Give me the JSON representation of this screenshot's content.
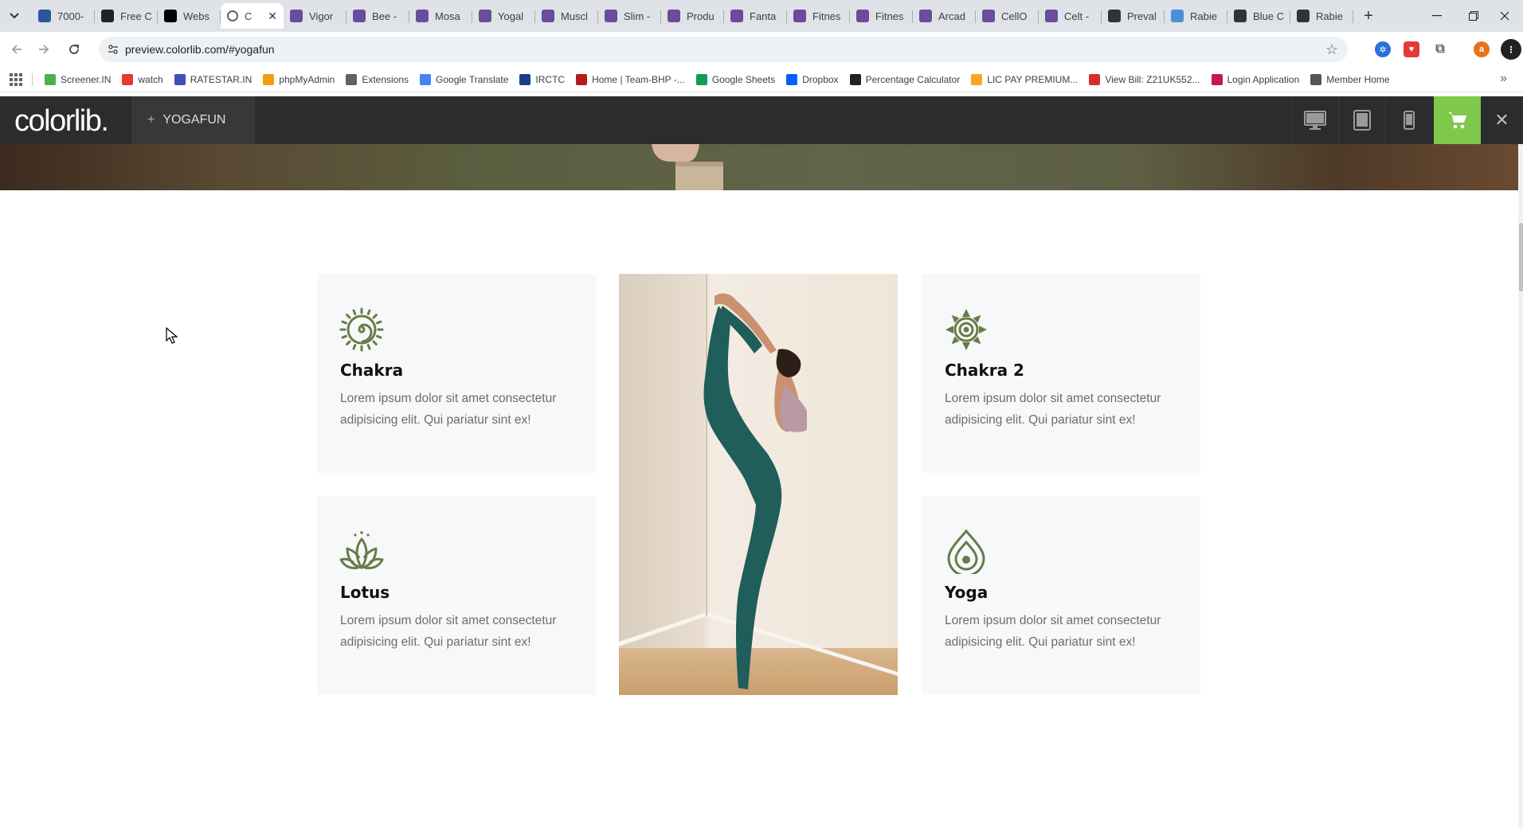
{
  "browser": {
    "tabs": [
      {
        "title": "7000-",
        "favicon": "word-icon",
        "color": "#2b579a"
      },
      {
        "title": "Free C",
        "favicon": "framer-icon",
        "color": "#222222"
      },
      {
        "title": "Webs",
        "favicon": "wix-icon",
        "color": "#000000"
      },
      {
        "title": "C",
        "favicon": "globe-icon",
        "color": "#5f6368",
        "active": true
      },
      {
        "title": "Vigor",
        "favicon": "colorlib-icon",
        "color": "#6b4c9a"
      },
      {
        "title": "Bee -",
        "favicon": "colorlib-icon",
        "color": "#6b4c9a"
      },
      {
        "title": "Mosa",
        "favicon": "colorlib-icon",
        "color": "#6b4c9a"
      },
      {
        "title": "Yogal",
        "favicon": "colorlib-icon",
        "color": "#6b4c9a"
      },
      {
        "title": "Muscl",
        "favicon": "colorlib-icon",
        "color": "#6b4c9a"
      },
      {
        "title": "Slim -",
        "favicon": "colorlib-icon",
        "color": "#6b4c9a"
      },
      {
        "title": "Produ",
        "favicon": "colorlib-icon",
        "color": "#6b4c9a"
      },
      {
        "title": "Fanta",
        "favicon": "colorlib-icon",
        "color": "#6b4c9a"
      },
      {
        "title": "Fitnes",
        "favicon": "colorlib-icon",
        "color": "#6b4c9a"
      },
      {
        "title": "Fitnes",
        "favicon": "colorlib-icon",
        "color": "#6b4c9a"
      },
      {
        "title": "Arcad",
        "favicon": "colorlib-icon",
        "color": "#6b4c9a"
      },
      {
        "title": "CellO",
        "favicon": "colorlib-icon",
        "color": "#6b4c9a"
      },
      {
        "title": "Celt -",
        "favicon": "colorlib-icon",
        "color": "#6b4c9a"
      },
      {
        "title": "Preval",
        "favicon": "wikipedia-icon",
        "color": "#333333"
      },
      {
        "title": "Rabie",
        "favicon": "who-icon",
        "color": "#4a90d9"
      },
      {
        "title": "Blue C",
        "favicon": "wikipedia-icon",
        "color": "#333333"
      },
      {
        "title": "Rabie",
        "favicon": "openai-icon",
        "color": "#333333"
      }
    ],
    "url": "preview.colorlib.com/#yogafun",
    "bookmarks": [
      {
        "label": "Screener.IN",
        "color": "#4caf50"
      },
      {
        "label": "watch",
        "color": "#e53935"
      },
      {
        "label": "RATESTAR.IN",
        "color": "#3f51b5"
      },
      {
        "label": "phpMyAdmin",
        "color": "#f39c12"
      },
      {
        "label": "Extensions",
        "color": "#5f6368"
      },
      {
        "label": "Google Translate",
        "color": "#4285f4"
      },
      {
        "label": "IRCTC",
        "color": "#1a3f8b"
      },
      {
        "label": "Home | Team-BHP -...",
        "color": "#b71c1c"
      },
      {
        "label": "Google Sheets",
        "color": "#0f9d58"
      },
      {
        "label": "Dropbox",
        "color": "#0061ff"
      },
      {
        "label": "Percentage Calculator",
        "color": "#222222"
      },
      {
        "label": "LIC PAY PREMIUM...",
        "color": "#f9a825"
      },
      {
        "label": "View Bill: Z21UK552...",
        "color": "#d32f2f"
      },
      {
        "label": "Login Application",
        "color": "#c2185b"
      },
      {
        "label": "Member Home",
        "color": "#555555"
      }
    ]
  },
  "preview": {
    "logo": "colorlib.",
    "theme_label": "YOGAFUN",
    "theme_prefix": "+",
    "accent": "#7ec94b"
  },
  "features": {
    "icon_color": "#6b7a47",
    "cards": [
      {
        "title": "Chakra",
        "text": "Lorem ipsum dolor sit amet consectetur adipisicing elit. Qui pariatur sint ex!",
        "icon": "sun-spiral-icon"
      },
      {
        "title": "Chakra 2",
        "text": "Lorem ipsum dolor sit amet consectetur adipisicing elit. Qui pariatur sint ex!",
        "icon": "mandala-icon"
      },
      {
        "title": "Lotus",
        "text": "Lorem ipsum dolor sit amet consectetur adipisicing elit. Qui pariatur sint ex!",
        "icon": "lotus-icon"
      },
      {
        "title": "Yoga",
        "text": "Lorem ipsum dolor sit amet consectetur adipisicing elit. Qui pariatur sint ex!",
        "icon": "drop-icon"
      }
    ]
  }
}
